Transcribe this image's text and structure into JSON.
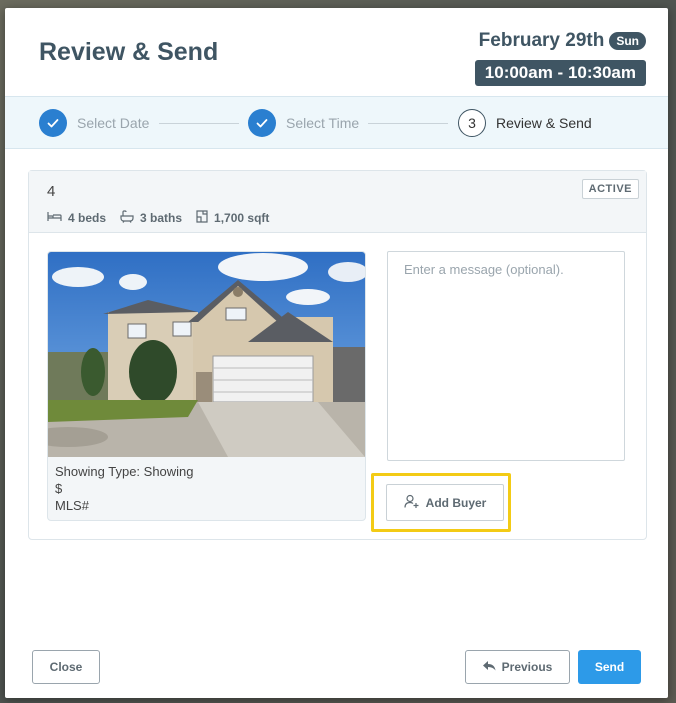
{
  "header": {
    "title": "Review & Send",
    "date": "February 29th",
    "day": "Sun",
    "time_range": "10:00am - 10:30am"
  },
  "steps": [
    {
      "label": "Select Date",
      "state": "complete"
    },
    {
      "label": "Select Time",
      "state": "complete"
    },
    {
      "label": "Review & Send",
      "number": "3",
      "state": "current"
    }
  ],
  "listing": {
    "number": "4",
    "status": "ACTIVE",
    "beds": "4 beds",
    "baths": "3 baths",
    "sqft": "1,700 sqft",
    "showing_type": "Showing Type: Showing",
    "price": "$",
    "mls": "MLS#"
  },
  "message": {
    "placeholder": "Enter a message (optional)."
  },
  "actions": {
    "add_buyer": "Add Buyer",
    "close": "Close",
    "previous": "Previous",
    "send": "Send"
  },
  "colors": {
    "accent": "#2a7fd0",
    "send_button": "#2d9ae8",
    "header_text": "#3f5563",
    "highlight": "#f3cb15"
  }
}
